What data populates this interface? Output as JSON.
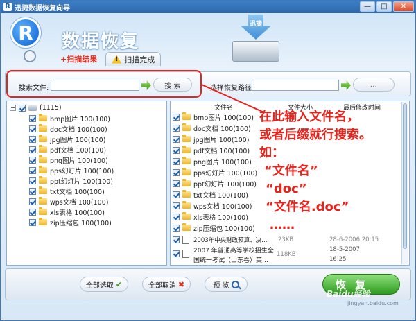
{
  "window": {
    "title": "迅捷数据恢复向导",
    "app_icon": "R",
    "minimize": "—",
    "maximize": "□",
    "close": "✕"
  },
  "header": {
    "logo_letter": "R",
    "brand": "数据恢复",
    "drive_label": "迅捷"
  },
  "tabs": [
    {
      "label": "+扫描结果",
      "active": true
    },
    {
      "label": "扫描完成",
      "active": false
    }
  ],
  "search": {
    "file_label": "搜索文件:",
    "file_value": "",
    "search_button": "搜 索",
    "path_label": "选择恢复路径",
    "path_value": "",
    "browse_button": "..."
  },
  "tree": {
    "root": "(1115)",
    "items": [
      "bmp图片 100(100)",
      "doc文档 100(100)",
      "jpg图片 100(100)",
      "pdf文档 100(100)",
      "png图片 100(100)",
      "pps幻灯片 100(100)",
      "ppt幻灯片 100(100)",
      "txt文档 100(100)",
      "wps文档 100(100)",
      "xls表格 100(100)",
      "zip压缩包 100(100)"
    ]
  },
  "file_list": {
    "columns": [
      "文件名",
      "文件大小",
      "最后修改时间"
    ],
    "folders": [
      "bmp图片 100(100)",
      "doc文档 100(100)",
      "jpg图片 100(100)",
      "pdf文档 100(100)",
      "png图片 100(100)",
      "pps幻灯片 100(100)",
      "ppt幻灯片 100(100)",
      "txt文档 100(100)",
      "wps文档 100(100)",
      "xls表格 100(100)",
      "zip压缩包 100(100)"
    ],
    "files": [
      {
        "name": "2003年中央财政预算、决…",
        "size": "23KB",
        "date": "28-6-2006 20:15"
      },
      {
        "name": "2007 年普通高等学校招生全国统一考试（山东卷）英…",
        "name_line1": "2007 年普通高等学校招生全",
        "name_line2": "国统一考试（山东卷）英…",
        "size": "118KB",
        "date": "18-5-2007",
        "time": "16:25"
      }
    ]
  },
  "annotation": {
    "lines": [
      "在此输入文件名，",
      "或者后缀就行搜索。",
      "如：",
      "“文件名”",
      "“doc”",
      "“文件名.doc”",
      "……"
    ]
  },
  "buttons": {
    "select_all": "全部选取",
    "cancel_all": "全部取消",
    "preview": "预 览",
    "recover": "恢 复"
  },
  "watermark": {
    "text": "Baidu经验",
    "sub": "jingyan.baidu.com"
  },
  "colors": {
    "accent_red": "#e8231c",
    "title_blue": "#2d68ab",
    "recover_green": "#2d9a1e"
  }
}
